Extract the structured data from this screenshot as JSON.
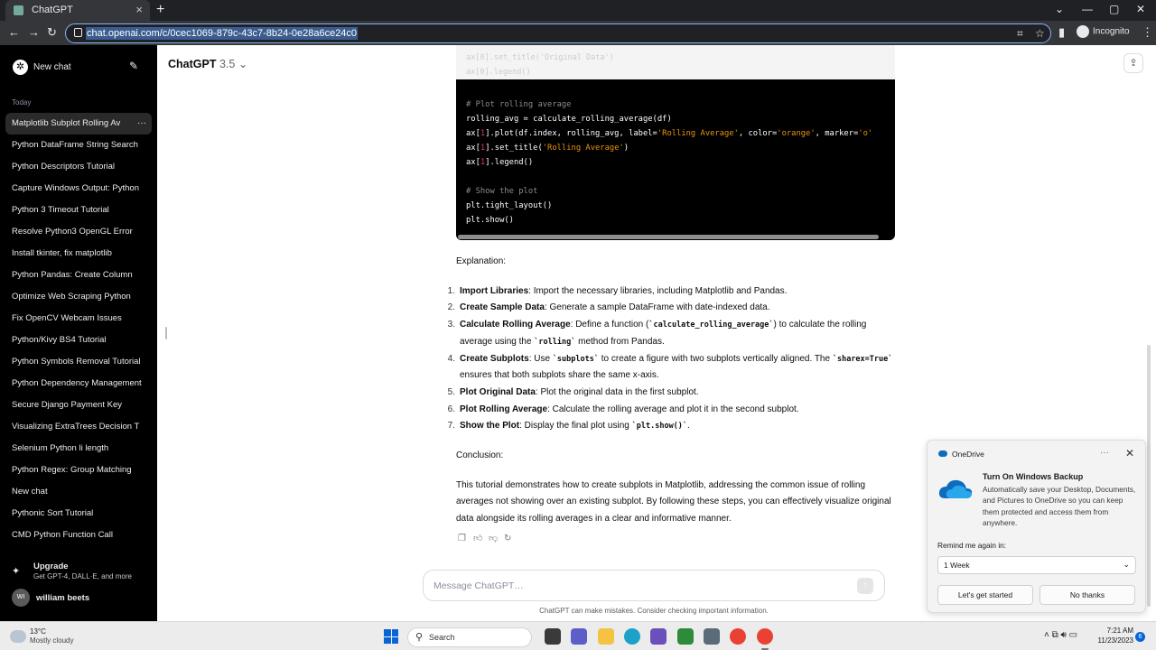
{
  "browser": {
    "tab_title": "ChatGPT",
    "new_tab_symbol": "+",
    "url": "chat.openai.com/c/0cec1069-879c-43c7-8b24-0e28a6ce24c0",
    "profile_label": "Incognito"
  },
  "sidebar": {
    "new_chat_label": "New chat",
    "section_label": "Today",
    "history": [
      "Matplotlib Subplot Rolling Av",
      "Python DataFrame String Search",
      "Python Descriptors Tutorial",
      "Capture Windows Output: Python",
      "Python 3 Timeout Tutorial",
      "Resolve Python3 OpenGL Error",
      "Install tkinter, fix matplotlib",
      "Python Pandas: Create Column",
      "Optimize Web Scraping Python",
      "Fix OpenCV Webcam Issues",
      "Python/Kivy BS4 Tutorial",
      "Python Symbols Removal Tutorial",
      "Python Dependency Management",
      "Secure Django Payment Key",
      "Visualizing ExtraTrees Decision T",
      "Selenium Python li length",
      "Python Regex: Group Matching",
      "New chat",
      "Pythonic Sort Tutorial",
      "CMD Python Function Call"
    ],
    "upgrade_title": "Upgrade",
    "upgrade_subtitle": "Get GPT-4, DALL·E, and more",
    "user_initials": "WI",
    "user_name": "william beets"
  },
  "header": {
    "model_name": "ChatGPT",
    "model_version": "3.5"
  },
  "code": {
    "top_faded": "ax[0].set_title('Original Data')\nax[0].legend()",
    "lines": [
      [
        {
          "t": "# Plot rolling average",
          "c": "cm"
        }
      ],
      [
        {
          "t": "rolling_avg = calculate_rolling_average(df)",
          "c": ""
        }
      ],
      [
        {
          "t": "ax[",
          "c": ""
        },
        {
          "t": "1",
          "c": "nu"
        },
        {
          "t": "].plot(df.index, rolling_avg, label=",
          "c": ""
        },
        {
          "t": "'Rolling Average'",
          "c": "st"
        },
        {
          "t": ", color=",
          "c": ""
        },
        {
          "t": "'orange'",
          "c": "st"
        },
        {
          "t": ", marker=",
          "c": ""
        },
        {
          "t": "'o'",
          "c": "st"
        }
      ],
      [
        {
          "t": "ax[",
          "c": ""
        },
        {
          "t": "1",
          "c": "nu"
        },
        {
          "t": "].set_title(",
          "c": ""
        },
        {
          "t": "'Rolling Average'",
          "c": "st"
        },
        {
          "t": ")",
          "c": ""
        }
      ],
      [
        {
          "t": "ax[",
          "c": ""
        },
        {
          "t": "1",
          "c": "nu"
        },
        {
          "t": "].legend()",
          "c": ""
        }
      ],
      [
        {
          "t": "",
          "c": ""
        }
      ],
      [
        {
          "t": "# Show the plot",
          "c": "cm"
        }
      ],
      [
        {
          "t": "plt.tight_layout()",
          "c": ""
        }
      ],
      [
        {
          "t": "plt.show()",
          "c": ""
        }
      ]
    ]
  },
  "answer": {
    "intro": "Explanation:",
    "steps": [
      {
        "num": "1.",
        "title": "Import Libraries",
        "parts": [
          ": Import the necessary libraries, including Matplotlib and Pandas."
        ]
      },
      {
        "num": "2.",
        "title": "Create Sample Data",
        "parts": [
          ": Generate a sample DataFrame with date-indexed data."
        ]
      },
      {
        "num": "3.",
        "title": "Calculate Rolling Average",
        "parts": [
          ": Define a function (",
          {
            "code": "`calculate_rolling_average`"
          },
          ") to calculate the rolling average using the ",
          {
            "code": "`rolling`"
          },
          " method from Pandas."
        ]
      },
      {
        "num": "4.",
        "title": "Create Subplots",
        "parts": [
          ": Use ",
          {
            "code": "`subplots`"
          },
          " to create a figure with two subplots vertically aligned. The ",
          {
            "code": "`sharex=True`"
          },
          " ensures that both subplots share the same x-axis."
        ]
      },
      {
        "num": "5.",
        "title": "Plot Original Data",
        "parts": [
          ": Plot the original data in the first subplot."
        ]
      },
      {
        "num": "6.",
        "title": "Plot Rolling Average",
        "parts": [
          ": Calculate the rolling average and plot it in the second subplot."
        ]
      },
      {
        "num": "7.",
        "title": "Show the Plot",
        "parts": [
          ": Display the final plot using ",
          {
            "code": "`plt.show()`"
          },
          "."
        ]
      }
    ],
    "conclusion_label": "Conclusion:",
    "conclusion": "This tutorial demonstrates how to create subplots in Matplotlib, addressing the common issue of rolling averages not showing over an existing subplot. By following these steps, you can effectively visualize original data alongside its rolling averages in a clear and informative manner."
  },
  "composer": {
    "placeholder": "Message ChatGPT…",
    "disclaimer": "ChatGPT can make mistakes. Consider checking important information."
  },
  "toast": {
    "app": "OneDrive",
    "title": "Turn On Windows Backup",
    "body": "Automatically save your Desktop, Documents, and Pictures to OneDrive so you can keep them protected and access them from anywhere.",
    "remind_label": "Remind me again in:",
    "remind_value": "1 Week",
    "primary": "Let's get started",
    "secondary": "No thanks"
  },
  "taskbar": {
    "temp": "13°C",
    "weather": "Mostly cloudy",
    "search_label": "Search",
    "time": "7:21 AM",
    "date": "11/23/2023",
    "notification_count": "6"
  },
  "colors": {
    "accent_blue": "#0a64d8",
    "code_string": "#e9950c",
    "code_number": "#df3079",
    "code_comment": "#8b8b8b",
    "sidebar_bg": "#000000"
  }
}
